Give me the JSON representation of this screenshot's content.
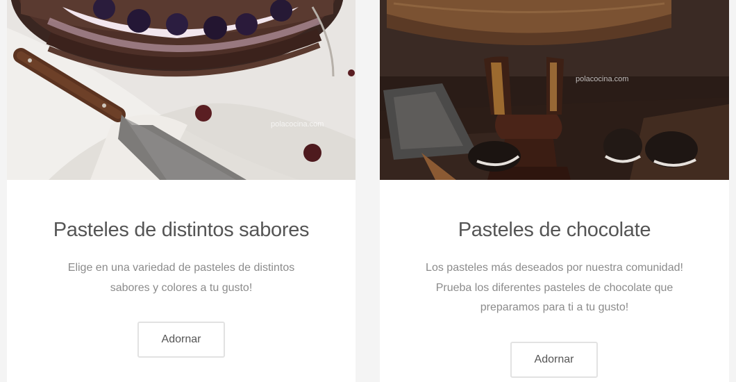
{
  "cards": [
    {
      "title": "Pasteles de distintos sabores",
      "description": "Elige en una variedad de pasteles de distintos sabores y colores a tu gusto!",
      "button_label": "Adornar",
      "image": "black-forest-cake-photo",
      "watermark": "polacocina.com"
    },
    {
      "title": "Pasteles de chocolate",
      "description": "Los pasteles más deseados por nuestra comunidad! Prueba los diferentes pasteles de chocolate que preparamos para ti a tu gusto!",
      "button_label": "Adornar",
      "image": "chocolate-cake-stand-photo",
      "watermark": "polacocina.com"
    }
  ],
  "colors": {
    "page_background": "#f4f4f4",
    "card_background": "#ffffff",
    "title_text": "#555555",
    "description_text": "#8b8b8b",
    "button_border": "#e2e2e2"
  }
}
